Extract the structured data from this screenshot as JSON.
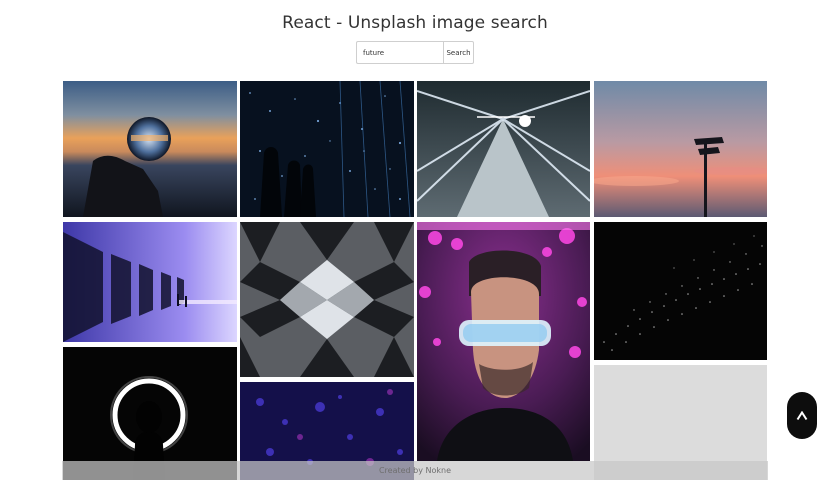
{
  "header": {
    "title": "React - Unsplash image search"
  },
  "search": {
    "value": "future",
    "button_label": "Search"
  },
  "gallery": {
    "images": [
      {
        "name": "crystal-ball-sunset-image"
      },
      {
        "name": "starry-light-tunnel-image"
      },
      {
        "name": "moving-walkway-light-trails-image"
      },
      {
        "name": "signpost-sunset-image"
      },
      {
        "name": "purple-tunnel-image"
      },
      {
        "name": "kaleidoscope-mirror-image"
      },
      {
        "name": "man-futuristic-glasses-image"
      },
      {
        "name": "dark-particle-wave-image"
      },
      {
        "name": "ring-light-silhouette-image"
      },
      {
        "name": "blue-purple-lights-image"
      },
      {
        "name": "gray-blank-image"
      }
    ]
  },
  "footer": {
    "text": "Created by Nokne"
  },
  "scroll_top": {
    "icon": "caret-up-icon"
  }
}
